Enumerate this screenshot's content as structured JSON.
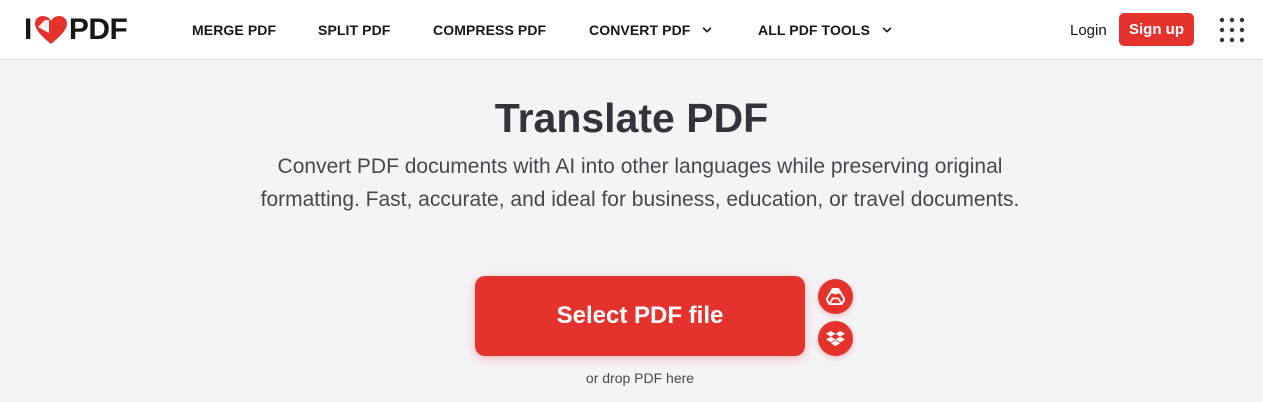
{
  "header": {
    "logo": {
      "prefix": "I",
      "suffix": "PDF",
      "heart_icon": "heart-icon",
      "brand_color": "#e5322d"
    },
    "nav": [
      {
        "label": "MERGE PDF",
        "has_dropdown": false
      },
      {
        "label": "SPLIT PDF",
        "has_dropdown": false
      },
      {
        "label": "COMPRESS PDF",
        "has_dropdown": false
      },
      {
        "label": "CONVERT PDF",
        "has_dropdown": true
      },
      {
        "label": "ALL PDF TOOLS",
        "has_dropdown": true
      }
    ],
    "login_label": "Login",
    "signup_label": "Sign up",
    "apps_icon": "grid-icon"
  },
  "main": {
    "title": "Translate PDF",
    "description": "Convert PDF documents with AI into other languages while preserving original formatting. Fast, accurate, and ideal for business, education, or travel documents.",
    "select_label": "Select PDF file",
    "cloud_sources": [
      {
        "icon": "google-drive-icon"
      },
      {
        "icon": "dropbox-icon"
      }
    ],
    "drop_hint": "or drop PDF here"
  },
  "colors": {
    "accent": "#e5322d",
    "background": "#f4f4f7",
    "text": "#33333b"
  }
}
